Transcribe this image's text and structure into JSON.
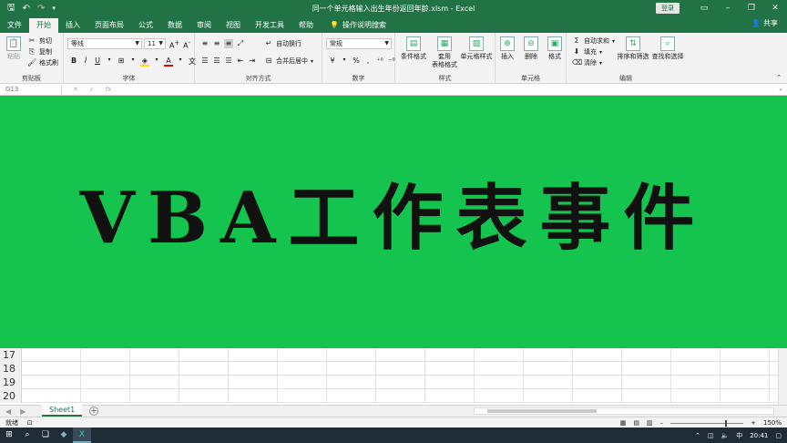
{
  "window": {
    "title": "同一个单元格输入出生年份返回年龄.xlsm  -  Excel",
    "login_label": "登录",
    "share_label": "共享",
    "tell_me": "操作说明搜索"
  },
  "tabs": [
    "文件",
    "开始",
    "插入",
    "页面布局",
    "公式",
    "数据",
    "审阅",
    "视图",
    "开发工具",
    "帮助"
  ],
  "active_tab": "开始",
  "ribbon": {
    "clipboard": {
      "label": "剪贴板",
      "paste": "粘贴",
      "cut": "剪切",
      "copy": "复制",
      "format_painter": "格式刷"
    },
    "font": {
      "label": "字体",
      "font_name": "等线",
      "font_size": "11"
    },
    "alignment": {
      "label": "对齐方式",
      "wrap_text": "自动换行",
      "merge_center": "合并后居中"
    },
    "number": {
      "label": "数字",
      "format": "常规"
    },
    "styles": {
      "label": "样式",
      "conditional": "条件格式",
      "table_line1": "套用",
      "table_line2": "表格格式",
      "cell_styles": "单元格样式"
    },
    "cells": {
      "label": "单元格",
      "insert": "插入",
      "delete": "删除",
      "format": "格式"
    },
    "editing": {
      "label": "编辑",
      "autosum": "自动求和",
      "fill": "填充",
      "clear": "清除",
      "sort_filter": "排序和筛选",
      "find_select": "查找和选择"
    }
  },
  "formula_bar": {
    "name_box": "G13"
  },
  "banner": {
    "text": "VBA工作表事件",
    "color": "#14c44f"
  },
  "rows": [
    "17",
    "18",
    "19",
    "20"
  ],
  "sheets": [
    "Sheet1"
  ],
  "status": {
    "ready": "就绪",
    "zoom": "150%",
    "zoom_fraction": 0.75
  },
  "taskbar": {
    "time": "20:41",
    "ime": "中"
  },
  "colors": {
    "excel_green": "#217346",
    "banner_green": "#14c44f"
  }
}
